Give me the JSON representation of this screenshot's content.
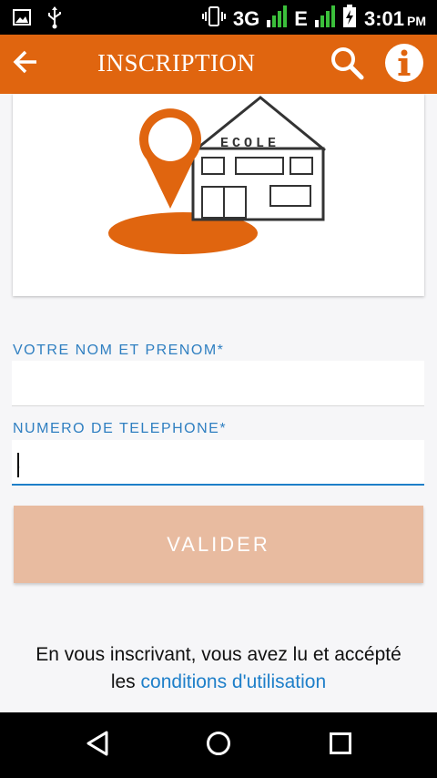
{
  "status_bar": {
    "network_type": "3G",
    "network_type_2": "E",
    "time": "3:01",
    "ampm": "PM",
    "icons": [
      "image-icon",
      "usb-icon",
      "vibrate-icon",
      "signal-icon",
      "battery-charging-icon"
    ]
  },
  "app_bar": {
    "title": "INSCRIPTION",
    "back_icon": "arrow-left-icon",
    "search_icon": "search-icon",
    "info_icon": "info-icon"
  },
  "logo": {
    "building_sign": "ECOLE"
  },
  "form": {
    "name_label": "VOTRE NOM ET PRENOM*",
    "name_value": "",
    "phone_label": "NUMERO DE TELEPHONE*",
    "phone_value": ".",
    "submit_label": "VALIDER"
  },
  "terms": {
    "line1": "En vous inscrivant, vous avez lu et accépté",
    "prefix": "les",
    "link": "conditions d'utilisation"
  },
  "colors": {
    "accent": "#e0650f",
    "link": "#1e7fc9",
    "button_disabled": "#e8bba0"
  }
}
